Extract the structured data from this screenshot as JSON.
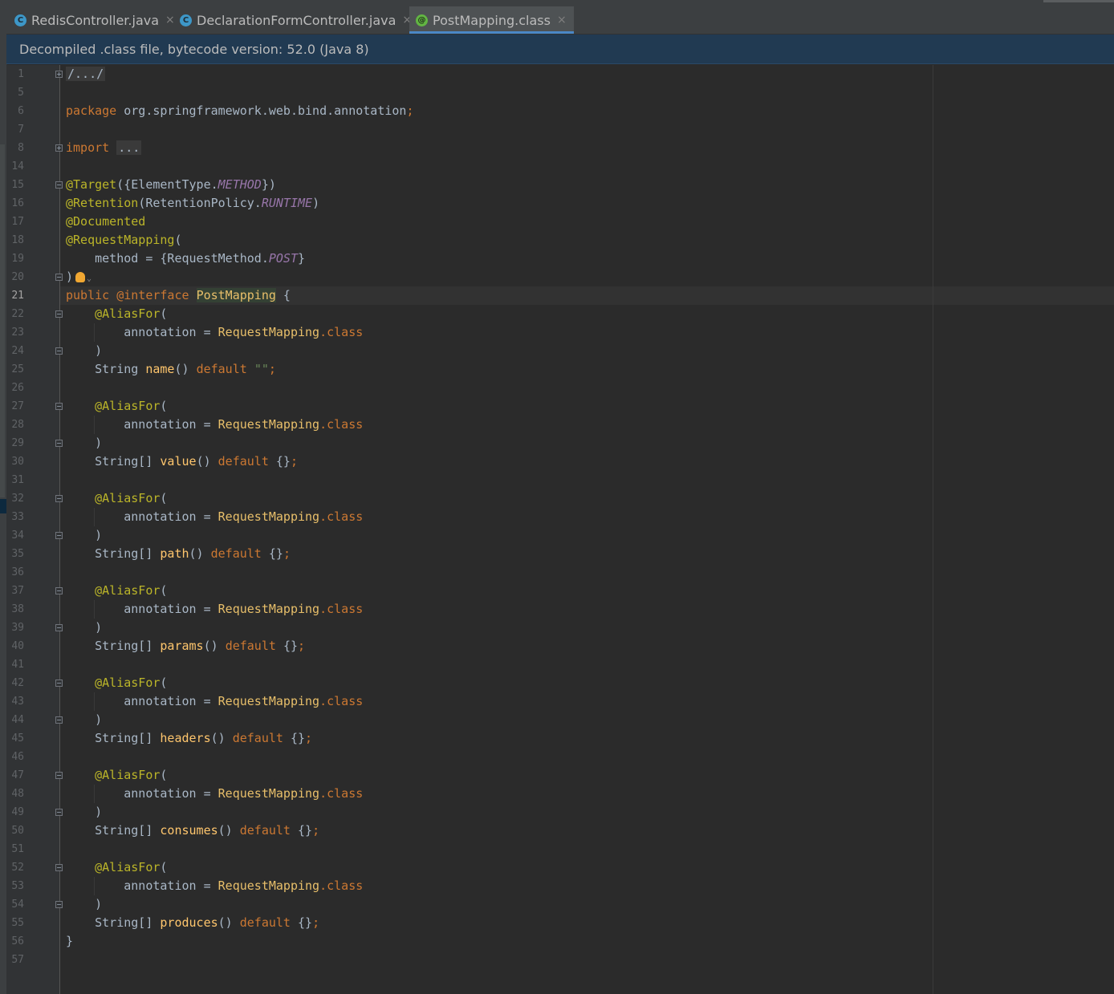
{
  "tabs": [
    {
      "label": "RedisController.java",
      "icon": "class-icon",
      "glyph": "C",
      "active": false
    },
    {
      "label": "DeclarationFormController.java",
      "icon": "class-icon",
      "glyph": "C",
      "active": false
    },
    {
      "label": "PostMapping.class",
      "icon": "annotation-icon",
      "glyph": "@",
      "active": true
    }
  ],
  "close_glyph": "×",
  "banner": "Decompiled .class file, bytecode version: 52.0 (Java 8)",
  "current_line": "21",
  "gutter": {
    "lines": [
      "1",
      "5",
      "6",
      "7",
      "8",
      "14",
      "15",
      "16",
      "17",
      "18",
      "19",
      "20",
      "21",
      "22",
      "23",
      "24",
      "25",
      "26",
      "27",
      "28",
      "29",
      "30",
      "31",
      "32",
      "33",
      "34",
      "35",
      "36",
      "37",
      "38",
      "39",
      "40",
      "41",
      "42",
      "43",
      "44",
      "45",
      "46",
      "47",
      "48",
      "49",
      "50",
      "51",
      "52",
      "53",
      "54",
      "55",
      "56",
      "57"
    ]
  },
  "code": {
    "header_fold": "/.../",
    "package_kw": "package",
    "package_name": " org.springframework.web.bind.annotation",
    "semicolon": ";",
    "import_kw": "import",
    "import_fold": "...",
    "target_ann": "@Target",
    "target_args_open": "({ElementType.",
    "target_const": "METHOD",
    "target_args_close": "})",
    "retention_ann": "@Retention",
    "retention_args_open": "(RetentionPolicy.",
    "retention_const": "RUNTIME",
    "retention_args_close": ")",
    "documented_ann": "@Documented",
    "reqmap_ann": "@RequestMapping",
    "open_paren": "(",
    "method_assign": "    method = {RequestMethod.",
    "method_const": "POST",
    "method_close": "}",
    "close_paren": ")",
    "public_kw": "public",
    "interface_kw": "@interface",
    "interface_name": "PostMapping",
    "open_brace": " {",
    "aliasfor_ann": "@AliasFor",
    "annotation_assign": "annotation = ",
    "reqmapping_ref": "RequestMapping",
    "dot_class": ".class",
    "close_brace": "}",
    "default_kw": "default",
    "name_type": "String",
    "name_method": "name",
    "name_default_value": "\"\"",
    "members": [
      {
        "type": "String[]",
        "method": "value"
      },
      {
        "type": "String[]",
        "method": "path"
      },
      {
        "type": "String[]",
        "method": "params"
      },
      {
        "type": "String[]",
        "method": "headers"
      },
      {
        "type": "String[]",
        "method": "consumes"
      },
      {
        "type": "String[]",
        "method": "produces"
      }
    ],
    "empty_array": "{}",
    "parens": "()"
  }
}
